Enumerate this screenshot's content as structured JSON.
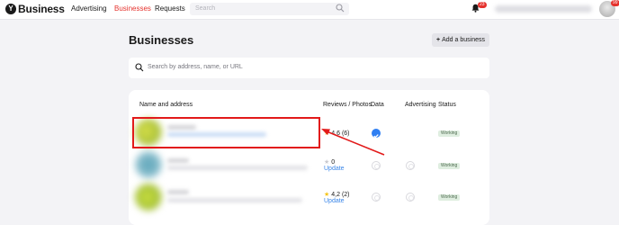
{
  "header": {
    "logo_letter": "Y",
    "logo_text": "Business",
    "nav": [
      "Advertising",
      "Businesses",
      "Requests"
    ],
    "search_placeholder": "Search",
    "bell_badge": "23",
    "avatar_badge": "99"
  },
  "page": {
    "title": "Businesses",
    "add_button": "Add a business",
    "search_placeholder": "Search by address, name, or URL"
  },
  "table": {
    "columns": [
      "Name and address",
      "Reviews / Photos",
      "Data",
      "Advertising",
      "Status"
    ],
    "rows": [
      {
        "rating": "4,6 (6)",
        "update": "",
        "data_checked": true,
        "status": "Working"
      },
      {
        "rating": "0",
        "update": "Update",
        "data_checked": false,
        "status": "Working"
      },
      {
        "rating": "4,2 (2)",
        "update": "Update",
        "data_checked": false,
        "status": "Working"
      }
    ]
  },
  "colors": {
    "accent": "#e5322d",
    "link": "#3a86e8",
    "highlight": "#e21a1a"
  }
}
